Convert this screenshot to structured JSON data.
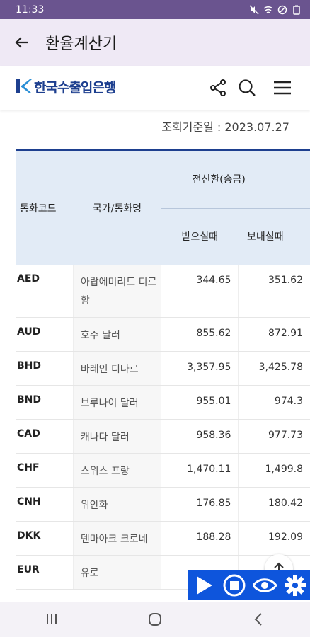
{
  "status": {
    "time": "11:33"
  },
  "appbar": {
    "title": "환율계산기"
  },
  "header": {
    "logo_text": "한국수출입은행"
  },
  "basedate": "조회기준일 : 2023.07.27",
  "table": {
    "col_code": "통화코드",
    "col_name": "국가/통화명",
    "col_group": "전신환(송금)",
    "col_receive": "받으실때",
    "col_send": "보내실때",
    "rows": [
      {
        "code": "AED",
        "name": "아랍에미리트 디르함",
        "receive": "344.65",
        "send": "351.62"
      },
      {
        "code": "AUD",
        "name": "호주 달러",
        "receive": "855.62",
        "send": "872.91"
      },
      {
        "code": "BHD",
        "name": "바레인 디나르",
        "receive": "3,357.95",
        "send": "3,425.78"
      },
      {
        "code": "BND",
        "name": "브루나이 달러",
        "receive": "955.01",
        "send": "974.3"
      },
      {
        "code": "CAD",
        "name": "캐나다 달러",
        "receive": "958.36",
        "send": "977.73"
      },
      {
        "code": "CHF",
        "name": "스위스 프랑",
        "receive": "1,470.11",
        "send": "1,499.8"
      },
      {
        "code": "CNH",
        "name": "위안화",
        "receive": "176.85",
        "send": "180.42"
      },
      {
        "code": "DKK",
        "name": "덴마아크 크로네",
        "receive": "188.28",
        "send": "192.09"
      },
      {
        "code": "EUR",
        "name": "유로",
        "receive": "",
        "send": ""
      }
    ]
  },
  "icons": {
    "back": "arrow-left-icon",
    "share": "share-icon",
    "search": "search-icon",
    "menu": "hamburger-icon",
    "play": "play-icon",
    "stop": "stop-icon",
    "eye": "eye-icon",
    "gear": "gear-icon"
  },
  "colors": {
    "statusbar": "#6a548f",
    "appbar": "#efe9f5",
    "brand": "#1d3f8f",
    "control": "#0e55dc"
  }
}
